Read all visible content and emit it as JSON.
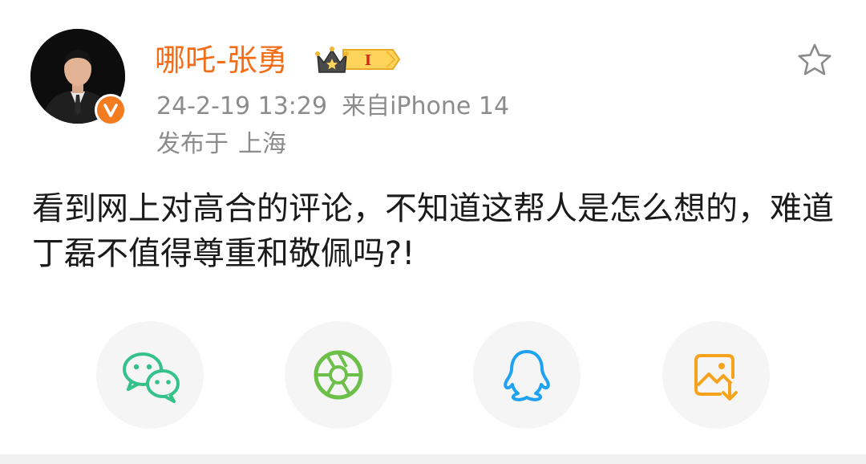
{
  "post": {
    "author": {
      "name": "哪吒-张勇",
      "verified": true,
      "vip_level": "I"
    },
    "timestamp": "24-2-19 13:29",
    "source": "来自iPhone 14",
    "location_prefix": "发布于",
    "location": "上海",
    "text": "看到网上对高合的评论，不知道这帮人是怎么想的，难道丁磊不值得尊重和敬佩吗?!"
  },
  "share": {
    "targets": [
      {
        "icon": "wechat-icon",
        "color": "#34c28a"
      },
      {
        "icon": "moments-icon",
        "color": "#6cc04a"
      },
      {
        "icon": "qq-icon",
        "color": "#1fa2f2"
      },
      {
        "icon": "save-image-icon",
        "color": "#f7a21b"
      }
    ]
  },
  "colors": {
    "accent": "#f36d19",
    "meta_text": "#8c8c8c",
    "body_text": "#1a1a1a"
  }
}
